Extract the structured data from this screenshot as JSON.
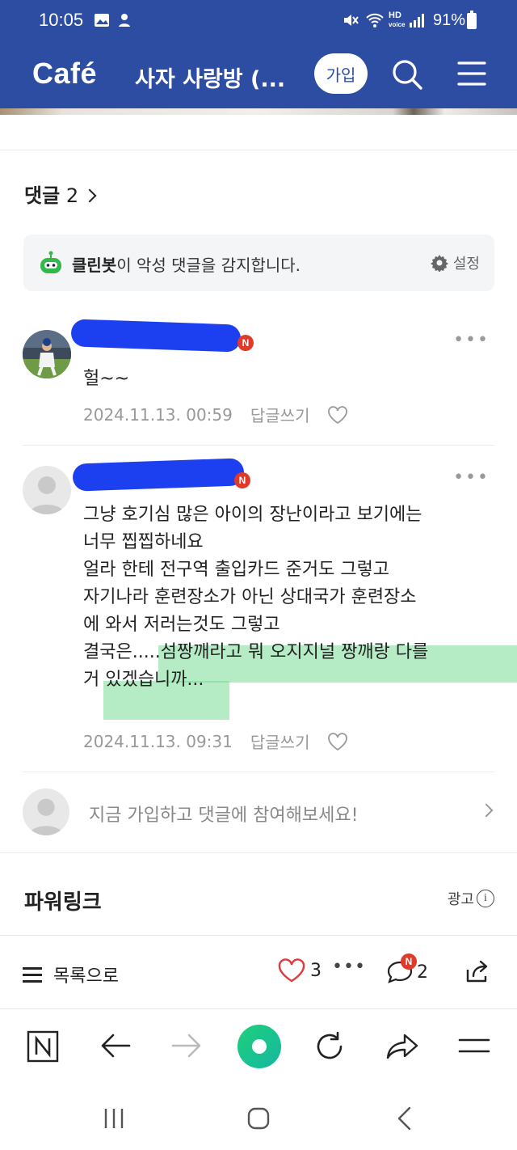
{
  "status_bar": {
    "time": "10:05",
    "right_text": "91%",
    "signal_label": "HD"
  },
  "header": {
    "logo": "Café",
    "cafe_name": "사자 사랑방 (...",
    "join_label": "가입",
    "accent": "#2d4da3"
  },
  "comments": {
    "heading": "댓글",
    "count": "2",
    "clean_bot": {
      "name": "클린봇",
      "text": "이 악성 댓글을 감지합니다.",
      "settings_label": "설정"
    },
    "items": [
      {
        "body": "헐~~",
        "date": "2024.11.13. 00:59",
        "reply_label": "답글쓰기",
        "badge": "N"
      },
      {
        "body": "그냥 호기심 많은 아이의 장난이라고 보기에는\n너무 찝찝하네요\n얼라 한테 전구역 출입카드 준거도 그렇고\n자기나라 훈련장소가 아닌 상대국가 훈련장소\n에 와서 저러는것도 그렇고\n결국은.....섬짱깨라고 뭐 오지지널 짱깨랑 다를\n거 있겠습니까...",
        "date": "2024.11.13. 09:31",
        "reply_label": "답글쓰기",
        "badge": "N"
      }
    ],
    "join_prompt": "지금 가입하고 댓글에 참여해보세요!"
  },
  "powerlink": {
    "title": "파워링크",
    "ad_label": "광고"
  },
  "article_bar": {
    "list_label": "목록으로",
    "like_count": "3",
    "comment_count": "2",
    "comment_badge": "N"
  },
  "icons": {
    "browser": [
      "naver-n-icon",
      "back-arrow-icon",
      "forward-arrow-icon",
      "home-green-icon",
      "refresh-icon",
      "share-icon",
      "menu-icon"
    ],
    "system": [
      "recent-apps-icon",
      "home-icon",
      "back-icon"
    ]
  }
}
